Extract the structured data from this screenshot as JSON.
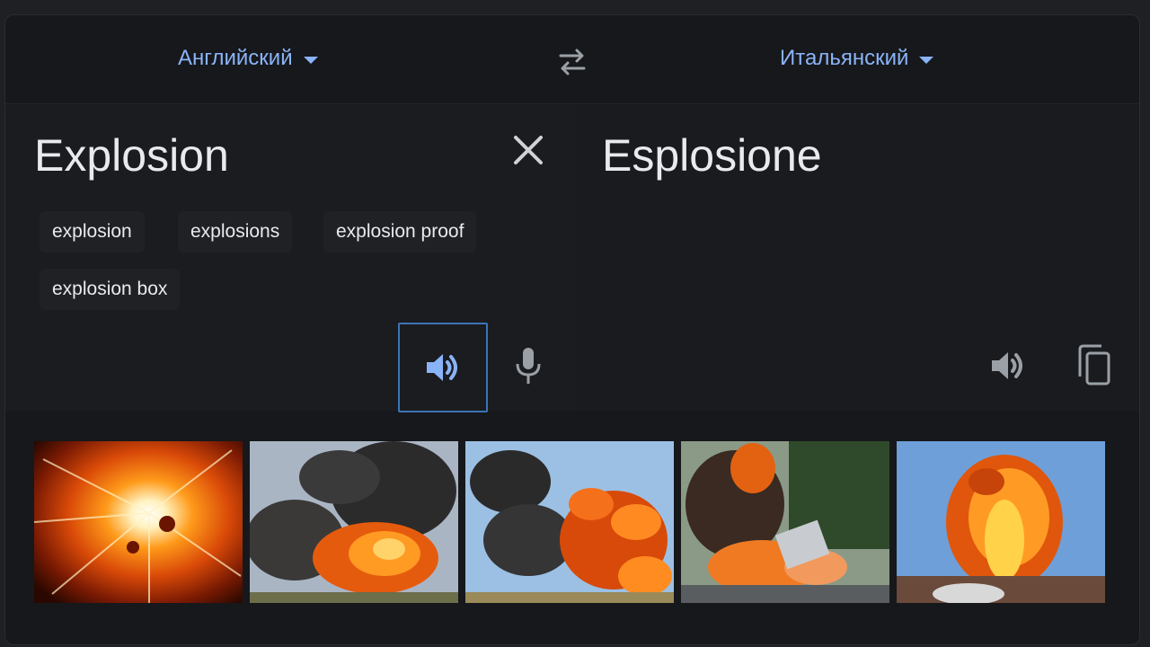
{
  "languages": {
    "source": "Английский",
    "target": "Итальянский"
  },
  "source": {
    "text": "Explosion",
    "suggestions": [
      "explosion",
      "explosions",
      "explosion proof",
      "explosion box"
    ]
  },
  "target": {
    "text": "Esplosione"
  },
  "images": {
    "count": 5
  },
  "colors": {
    "accent": "#8ab4f8",
    "background": "#17181b",
    "text": "#e8eaed",
    "icon": "#9aa0a6"
  },
  "icons": {
    "swap": "swap-icon",
    "clear": "close-icon",
    "speak": "speaker-icon",
    "mic": "microphone-icon",
    "copy": "copy-icon"
  }
}
